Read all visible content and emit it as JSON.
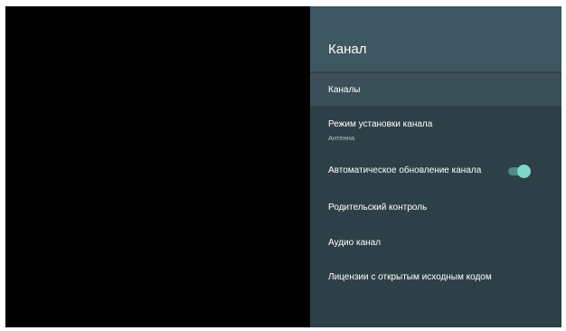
{
  "panel": {
    "title": "Канал",
    "items": [
      {
        "label": "Каналы",
        "selected": true
      },
      {
        "label": "Режим установки канала",
        "sublabel": "Антенна"
      },
      {
        "label": "Автоматическое обновление канала",
        "toggle": "on"
      },
      {
        "label": "Родительский контроль"
      },
      {
        "label": "Аудио канал"
      },
      {
        "label": "Лицензии с открытым исходным кодом"
      }
    ]
  },
  "colors": {
    "panel_background": "#2e4047",
    "header_background": "#3e5760",
    "selected_background": "#3a4f57",
    "toggle_accent": "#7fd6c8"
  }
}
